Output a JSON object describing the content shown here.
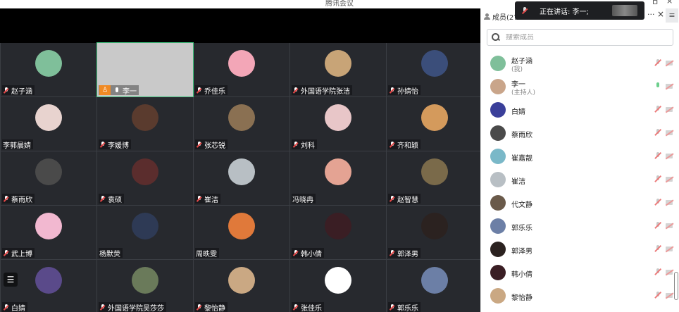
{
  "window": {
    "title": "腾讯会议",
    "min_glyph": "ㅁ",
    "close_glyph": "×"
  },
  "speaking_toast": {
    "text": "正在讲话: 李一;"
  },
  "grid": {
    "list_button_glyph": "☰",
    "tiles": [
      {
        "name": "赵子涵",
        "muted": true,
        "avatar_color": "#7fbf9a"
      },
      {
        "name": "李一",
        "muted": false,
        "host": true,
        "active": true,
        "avatar_color": "#c9c9c9"
      },
      {
        "name": "乔佳乐",
        "muted": true,
        "avatar_color": "#f3a6b7"
      },
      {
        "name": "外国语学院张洁",
        "muted": true,
        "avatar_color": "#c8a477"
      },
      {
        "name": "孙婧怡",
        "muted": true,
        "avatar_color": "#3b4e7a"
      },
      {
        "name": "李郭晨婧",
        "muted": false,
        "avatar_color": "#e8d3cf"
      },
      {
        "name": "李媛博",
        "muted": true,
        "avatar_color": "#5a3b2e"
      },
      {
        "name": "张芯锐",
        "muted": true,
        "avatar_color": "#8a7052"
      },
      {
        "name": "刘科",
        "muted": true,
        "avatar_color": "#e8c6c8"
      },
      {
        "name": "齐和颖",
        "muted": true,
        "avatar_color": "#d49a5c"
      },
      {
        "name": "蔡雨欣",
        "muted": true,
        "avatar_color": "#4a4a4a"
      },
      {
        "name": "袁硕",
        "muted": true,
        "avatar_color": "#5b2d2d"
      },
      {
        "name": "崔洁",
        "muted": true,
        "avatar_color": "#b8bfc4"
      },
      {
        "name": "冯晓冉",
        "muted": false,
        "avatar_color": "#e4a393"
      },
      {
        "name": "赵智慧",
        "muted": true,
        "avatar_color": "#7a6a4a"
      },
      {
        "name": "武上博",
        "muted": true,
        "avatar_color": "#f2b8d0"
      },
      {
        "name": "杨默荧",
        "muted": false,
        "avatar_color": "#2e3a55"
      },
      {
        "name": "周昳雯",
        "muted": false,
        "avatar_color": "#e0793a"
      },
      {
        "name": "韩小倩",
        "muted": true,
        "avatar_color": "#3a1e24"
      },
      {
        "name": "郭泽男",
        "muted": true,
        "avatar_color": "#2b2220"
      },
      {
        "name": "白婧",
        "muted": true,
        "avatar_color": "#5a4a8a"
      },
      {
        "name": "外国语学院吴莎莎",
        "muted": true,
        "avatar_color": "#6a7a5a"
      },
      {
        "name": "黎怡静",
        "muted": true,
        "avatar_color": "#caa883"
      },
      {
        "name": "张佳乐",
        "muted": true,
        "avatar_color": "#ffffff"
      },
      {
        "name": "郭乐乐",
        "muted": true,
        "avatar_color": "#6c7fa6"
      }
    ]
  },
  "panel": {
    "title": "成员(27",
    "more_glyph": "···",
    "close_glyph": "×",
    "menu_glyph": "≡",
    "search_placeholder": "搜索成员",
    "members": [
      {
        "name": "赵子涵",
        "sub": "(我)",
        "mic": "muted",
        "avatar_color": "#7fbf9a"
      },
      {
        "name": "李一",
        "sub": "(主持人)",
        "mic": "on",
        "avatar_color": "#c9a58a"
      },
      {
        "name": "白婧",
        "sub": "",
        "mic": "muted",
        "avatar_color": "#3a3f9a"
      },
      {
        "name": "蔡雨欣",
        "sub": "",
        "mic": "muted",
        "avatar_color": "#4a4a4a"
      },
      {
        "name": "崔嘉靓",
        "sub": "",
        "mic": "muted",
        "avatar_color": "#7ab8c8"
      },
      {
        "name": "崔洁",
        "sub": "",
        "mic": "muted",
        "avatar_color": "#b8bfc4"
      },
      {
        "name": "代文静",
        "sub": "",
        "mic": "muted",
        "avatar_color": "#6a5a4a"
      },
      {
        "name": "郭乐乐",
        "sub": "",
        "mic": "muted",
        "avatar_color": "#6c7fa6"
      },
      {
        "name": "郭泽男",
        "sub": "",
        "mic": "muted",
        "avatar_color": "#2b2220"
      },
      {
        "name": "韩小倩",
        "sub": "",
        "mic": "muted",
        "avatar_color": "#3a1e24"
      },
      {
        "name": "黎怡静",
        "sub": "",
        "mic": "muted",
        "avatar_color": "#caa883"
      }
    ]
  }
}
